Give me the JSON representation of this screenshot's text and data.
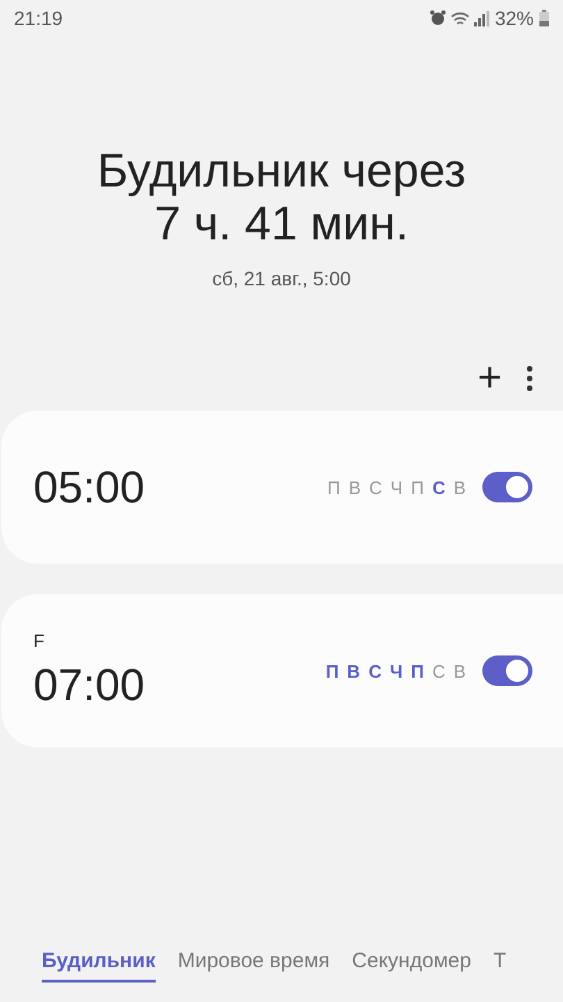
{
  "status_bar": {
    "time": "21:19",
    "battery": "32%"
  },
  "header": {
    "title_line1": "Будильник через",
    "title_line2": "7 ч. 41 мин.",
    "subtitle": "сб, 21 авг., 5:00"
  },
  "toolbar": {
    "add": "+"
  },
  "alarms": [
    {
      "time": "05:00",
      "on": true,
      "days": [
        {
          "letter": "П",
          "selected": false
        },
        {
          "letter": "В",
          "selected": false
        },
        {
          "letter": "С",
          "selected": false
        },
        {
          "letter": "Ч",
          "selected": false
        },
        {
          "letter": "П",
          "selected": false
        },
        {
          "letter": "С",
          "selected": true
        },
        {
          "letter": "В",
          "selected": false
        }
      ]
    },
    {
      "label": "F",
      "time": "07:00",
      "on": true,
      "days": [
        {
          "letter": "П",
          "selected": true
        },
        {
          "letter": "В",
          "selected": true
        },
        {
          "letter": "С",
          "selected": true
        },
        {
          "letter": "Ч",
          "selected": true
        },
        {
          "letter": "П",
          "selected": true
        },
        {
          "letter": "С",
          "selected": false
        },
        {
          "letter": "В",
          "selected": false
        }
      ]
    }
  ],
  "tabs": [
    {
      "label": "Будильник",
      "selected": true
    },
    {
      "label": "Мировое время",
      "selected": false
    },
    {
      "label": "Секундомер",
      "selected": false
    },
    {
      "label": "Т",
      "selected": false
    }
  ]
}
